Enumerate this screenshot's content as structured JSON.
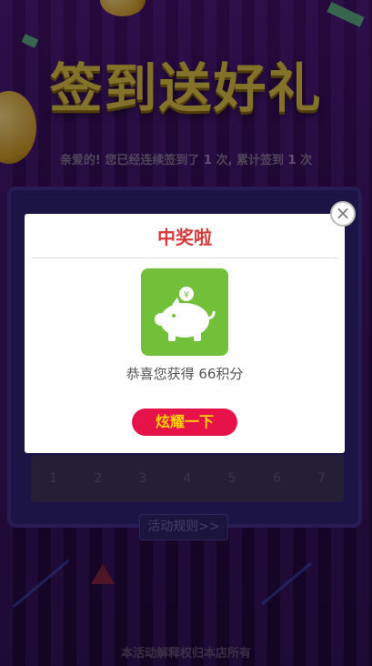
{
  "page": {
    "title": "签到送好礼",
    "streak": {
      "prefix": "亲爱的! 您已经连续签到了",
      "consecutive": "1",
      "middle": "次, 累计签到",
      "total": "1",
      "suffix": "次"
    },
    "calendar": {
      "days": [
        "1",
        "2",
        "3",
        "4",
        "5",
        "6",
        "7"
      ]
    },
    "rules_label": "活动规则>>",
    "footer": "本活动解释权归本店所有"
  },
  "modal": {
    "title": "中奖啦",
    "prize_text": "恭喜您获得 66积分",
    "share_label": "炫耀一下",
    "close_glyph": "×",
    "coin_symbol": "¥",
    "prize_icon": "piggy-bank-icon",
    "accent_color": "#e6124a",
    "tile_color": "#72c03a"
  }
}
